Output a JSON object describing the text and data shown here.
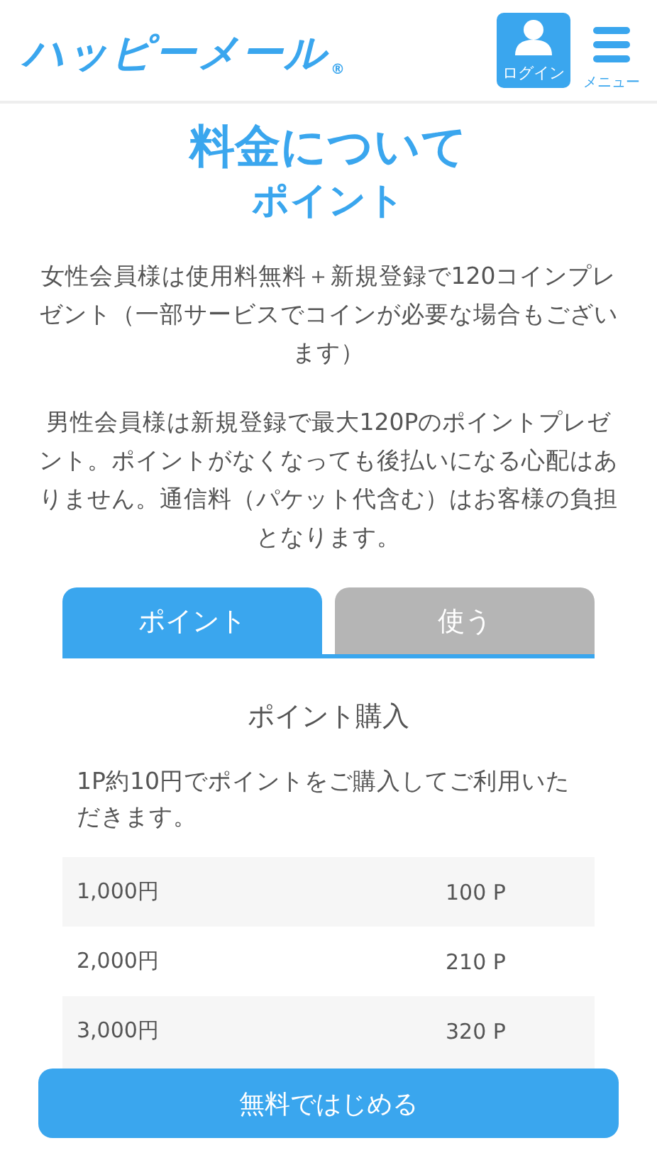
{
  "header": {
    "logo": "ハッピーメール",
    "logo_mark": "®",
    "login": "ログイン",
    "menu": "メニュー"
  },
  "title": "料金について",
  "subtitle": "ポイント",
  "paragraphs": [
    "女性会員様は使用料無料＋新規登録で120コインプレゼント（一部サービスでコインが必要な場合もございます）",
    "男性会員様は新規登録で最大120Pのポイントプレゼント。ポイントがなくなっても後払いになる心配はありません。通信料（パケット代含む）はお客様の負担となります。"
  ],
  "tabs": [
    {
      "label": "ポイント",
      "selected": true
    },
    {
      "label": "使う",
      "selected": false
    }
  ],
  "section_title": "ポイント購入",
  "section_text": "1P約10円でポイントをご購入してご利用いただきます。",
  "price_rows": [
    {
      "price": "1,000円",
      "points": "100 P"
    },
    {
      "price": "2,000円",
      "points": "210 P"
    },
    {
      "price": "3,000円",
      "points": "320 P"
    }
  ],
  "cta": "無料ではじめる"
}
